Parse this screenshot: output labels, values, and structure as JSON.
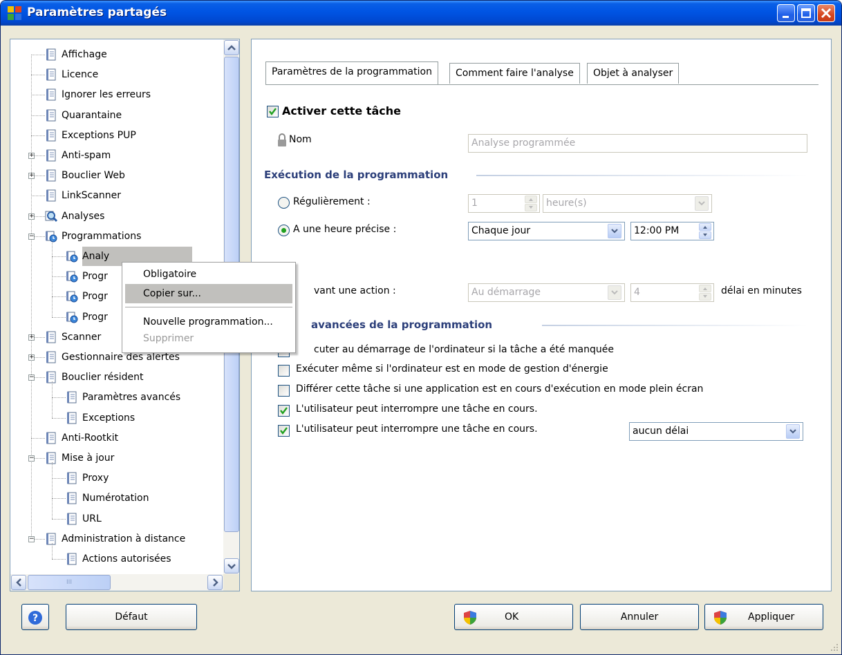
{
  "window": {
    "title": "Paramètres partagés"
  },
  "tree": {
    "items": [
      {
        "label": "Affichage"
      },
      {
        "label": "Licence"
      },
      {
        "label": "Ignorer les erreurs"
      },
      {
        "label": "Quarantaine"
      },
      {
        "label": "Exceptions PUP"
      },
      {
        "label": "Anti-spam"
      },
      {
        "label": "Bouclier Web"
      },
      {
        "label": "LinkScanner"
      },
      {
        "label": "Analyses"
      },
      {
        "label": "Programmations"
      },
      {
        "label": "Analy"
      },
      {
        "label": "Progr"
      },
      {
        "label": "Progr"
      },
      {
        "label": "Progr"
      },
      {
        "label": "Scanner"
      },
      {
        "label": "Gestionnaire des alertes"
      },
      {
        "label": "Bouclier résident"
      },
      {
        "label": "Paramètres avancés"
      },
      {
        "label": "Exceptions"
      },
      {
        "label": "Anti-Rootkit"
      },
      {
        "label": "Mise à jour"
      },
      {
        "label": "Proxy"
      },
      {
        "label": "Numérotation"
      },
      {
        "label": "URL"
      },
      {
        "label": "Administration à distance"
      },
      {
        "label": "Actions autorisées"
      }
    ]
  },
  "context_menu": {
    "items": [
      {
        "label": "Obligatoire"
      },
      {
        "label": "Copier sur..."
      },
      {
        "label": "Nouvelle programmation..."
      },
      {
        "label": "Supprimer"
      }
    ]
  },
  "tabs": [
    {
      "label": "Paramètres de la programmation"
    },
    {
      "label": "Comment faire l'analyse"
    },
    {
      "label": "Objet à analyser"
    }
  ],
  "form": {
    "enable_task": "Activer cette tâche",
    "name_label": "Nom",
    "name_value": "Analyse programmée",
    "execution_section": "Exécution de la programmation",
    "regularly_label": "Régulièrement :",
    "interval_value": "1",
    "interval_unit": "heure(s)",
    "specific_time_label": "A une heure précise :",
    "frequency_value": "Chaque jour",
    "time_value": "12:00 PM",
    "after_action_label": "vant une action :",
    "action_value": "Au démarrage",
    "delay_value": "4",
    "delay_unit": "délai en minutes",
    "advanced_section": "avancées de la programmation",
    "options": [
      {
        "label": "cuter au démarrage de l'ordinateur si la tâche a été manquée",
        "checked": false
      },
      {
        "label": "Exécuter même si l'ordinateur est en mode de gestion d'énergie",
        "checked": false
      },
      {
        "label": "Différer cette tâche si une application est en cours d'exécution en mode plein écran",
        "checked": false
      },
      {
        "label": "L'utilisateur peut interrompre une tâche en cours.",
        "checked": true
      },
      {
        "label": "L'utilisateur peut interrompre une tâche en cours.",
        "checked": true
      }
    ],
    "interrupt_delay_value": "aucun délai"
  },
  "buttons": {
    "default": "Défaut",
    "ok": "OK",
    "cancel": "Annuler",
    "apply": "Appliquer"
  },
  "scrollbar": {
    "grip_text": "III"
  },
  "colors": {
    "titlebar": "#0054e3",
    "section_text": "#2c3f7a",
    "check": "#21a121"
  }
}
